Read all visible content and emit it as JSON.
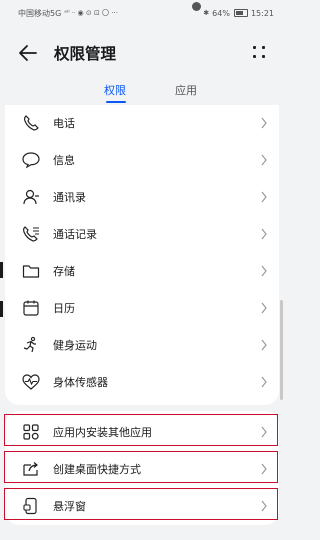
{
  "status_bar": {
    "carrier": "中国移动5G",
    "signal_icons": "ᵃᴵˡ ᐧᐧ ◉ ⊙ ⊡ 〇 ···",
    "battery": "64%",
    "time": "15:21"
  },
  "header": {
    "title": "权限管理"
  },
  "tabs": [
    {
      "label": "权限",
      "active": true
    },
    {
      "label": "应用",
      "active": false
    }
  ],
  "permissions": [
    {
      "label": "电话",
      "icon": "phone-icon"
    },
    {
      "label": "信息",
      "icon": "message-icon"
    },
    {
      "label": "通讯录",
      "icon": "contacts-icon"
    },
    {
      "label": "通话记录",
      "icon": "call-log-icon"
    },
    {
      "label": "存储",
      "icon": "folder-icon"
    },
    {
      "label": "日历",
      "icon": "calendar-icon"
    },
    {
      "label": "健身运动",
      "icon": "running-icon"
    },
    {
      "label": "身体传感器",
      "icon": "heart-rate-icon"
    }
  ],
  "special_permissions": [
    {
      "label": "应用内安装其他应用",
      "icon": "apps-grid-icon"
    },
    {
      "label": "创建桌面快捷方式",
      "icon": "shortcut-icon"
    },
    {
      "label": "悬浮窗",
      "icon": "floating-window-icon"
    }
  ],
  "colors": {
    "accent": "#0a59f7",
    "highlight_border": "#c8102e",
    "background": "#f1f3f5"
  }
}
